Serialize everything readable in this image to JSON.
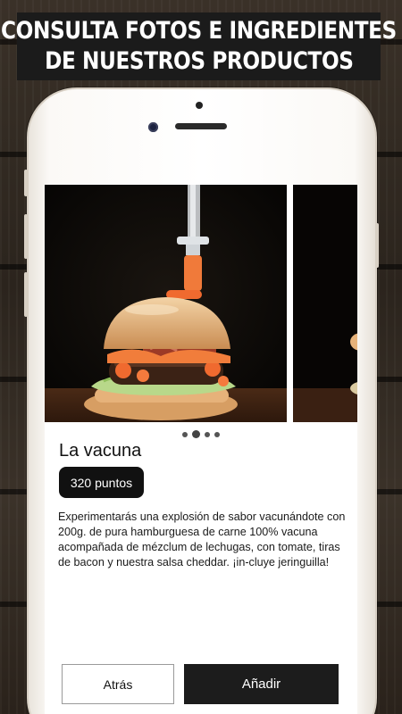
{
  "banner": {
    "line1": "CONSULTA FOTOS E INGREDIENTES",
    "line2": "DE NUESTROS PRODUCTOS"
  },
  "product": {
    "title": "La vacuna",
    "points": "320 puntos",
    "description": "Experimentarás una explosión de sabor vacunándote con 200g. de pura hamburguesa de carne 100% vacuna acompañada de mézclum de lechugas, con tomate, tiras de bacon y nuestra salsa cheddar. ¡in-cluye jeringuilla!"
  },
  "carousel": {
    "images": [
      "burger-with-syringe-photo",
      "burger-photo-next"
    ],
    "dots": 4,
    "active_dot": 1
  },
  "actions": {
    "back_label": "Atrás",
    "add_label": "Añadir"
  },
  "colors": {
    "banner_bg": "#1b1b1b",
    "button_dark": "#1c1c1c",
    "sauce_orange": "#f06a2f"
  }
}
